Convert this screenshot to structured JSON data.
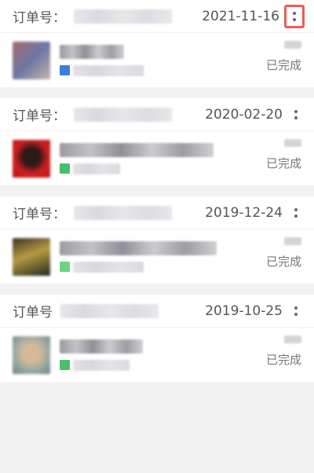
{
  "orders": [
    {
      "label": "订单号：",
      "date": "2021-11-16",
      "status": "已完成",
      "thumb_colors": [
        "#a9696e",
        "#6a78a6",
        "#c7b2a6"
      ],
      "badge_color": "#3a7fdc",
      "title_width": 82,
      "sub_width": 90,
      "menu_highlighted": true
    },
    {
      "label": "订单号：",
      "date": "2020-02-20",
      "status": "已完成",
      "thumb_colors": [
        "#d21e1e",
        "#2a1a1a",
        "#b51616"
      ],
      "badge_color": "#45c06a",
      "title_width": 196,
      "sub_width": 60,
      "menu_highlighted": false
    },
    {
      "label": "订单号：",
      "date": "2019-12-24",
      "status": "已完成",
      "thumb_colors": [
        "#3c3220",
        "#b79a44",
        "#1f2b1e"
      ],
      "badge_color": "#6cd37f",
      "title_width": 200,
      "sub_width": 90,
      "menu_highlighted": false
    },
    {
      "label": "订单号",
      "date": "2019-10-25",
      "status": "已完成",
      "thumb_colors": [
        "#93a6a6",
        "#d7b998",
        "#6b8282"
      ],
      "badge_color": "#48c068",
      "title_width": 106,
      "sub_width": 72,
      "menu_highlighted": false
    }
  ]
}
